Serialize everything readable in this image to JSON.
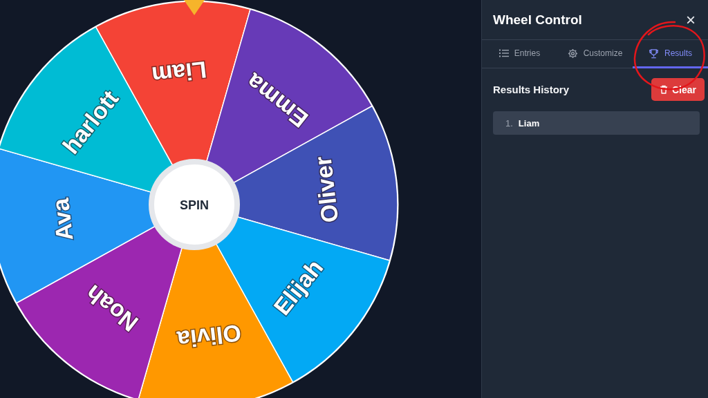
{
  "wheel": {
    "segments": [
      {
        "label": "Liam",
        "color": "#f44336"
      },
      {
        "label": "Emma",
        "color": "#673ab7"
      },
      {
        "label": "Oliver",
        "color": "#3f51b5"
      },
      {
        "label": "Elijah",
        "color": "#03a9f4"
      },
      {
        "label": "Olivia",
        "color": "#ff9800"
      },
      {
        "label": "Noah",
        "color": "#9c27b0"
      },
      {
        "label": "Ava",
        "color": "#2196f3"
      },
      {
        "label": "harlott",
        "color": "#00bcd4"
      }
    ],
    "spin_button": "SPIN"
  },
  "panel": {
    "title": "Wheel Control",
    "close": "×",
    "tabs": [
      {
        "label": "Entries",
        "selected": false
      },
      {
        "label": "Customize",
        "selected": false
      },
      {
        "label": "Results",
        "selected": true
      }
    ],
    "results_title": "Results History",
    "clear_button": "Clear",
    "results": [
      {
        "number": "1.",
        "name": "Liam"
      }
    ]
  }
}
